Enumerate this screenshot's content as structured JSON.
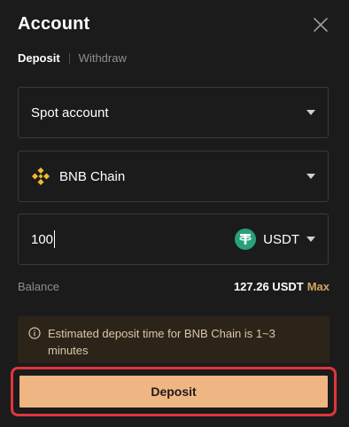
{
  "header": {
    "title": "Account",
    "close_icon": "close-icon"
  },
  "tabs": [
    {
      "label": "Deposit",
      "active": true
    },
    {
      "label": "Withdraw",
      "active": false
    }
  ],
  "account_select": {
    "value": "Spot account"
  },
  "network_select": {
    "value": "BNB Chain",
    "icon": "bnb-chain-icon"
  },
  "amount_input": {
    "value": "100",
    "token": "USDT",
    "token_icon": "usdt-icon"
  },
  "balance": {
    "label": "Balance",
    "value": "127.26 USDT",
    "max_label": "Max"
  },
  "notice": {
    "icon": "info-icon",
    "text": "Estimated deposit time for BNB Chain is 1~3 minutes"
  },
  "deposit_button": {
    "label": "Deposit"
  },
  "colors": {
    "background": "#1b1b1b",
    "accent": "#efb583",
    "highlight": "#e0353b",
    "max": "#d4a562",
    "usdt": "#26a17b",
    "bnb": "#f3ba2f"
  }
}
